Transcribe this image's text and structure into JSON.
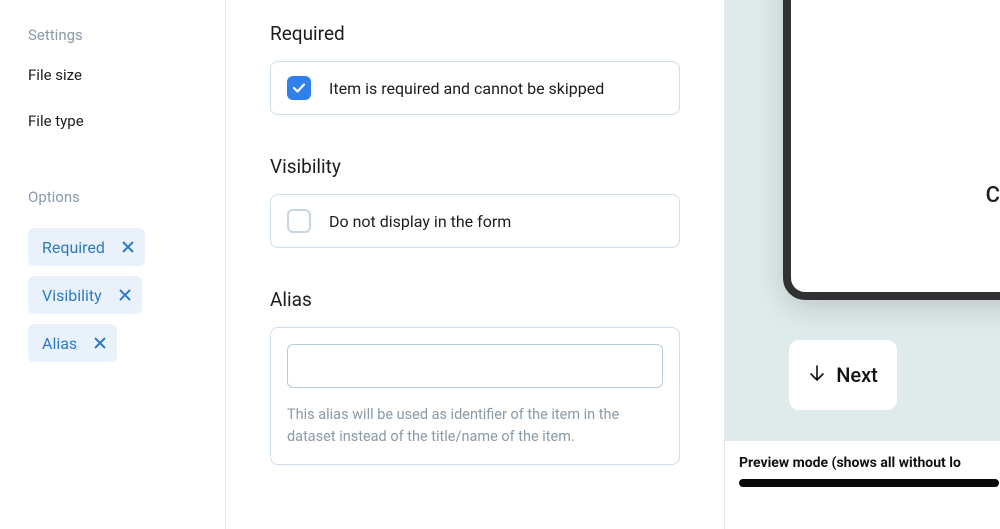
{
  "sidebar": {
    "settings_heading": "Settings",
    "settings_items": [
      "File size",
      "File type"
    ],
    "options_heading": "Options",
    "option_chips": [
      "Required",
      "Visibility",
      "Alias"
    ]
  },
  "form": {
    "required": {
      "title": "Required",
      "label": "Item is required and cannot be skipped",
      "checked": true
    },
    "visibility": {
      "title": "Visibility",
      "label": "Do not display in the form",
      "checked": false
    },
    "alias": {
      "title": "Alias",
      "value": "",
      "help": "This alias will be used as identifier of the item in the dataset instead of the title/name of the item."
    }
  },
  "preview": {
    "cut_letter": "C",
    "next_label": "Next",
    "footer_label": "Preview mode (shows all without lo"
  }
}
